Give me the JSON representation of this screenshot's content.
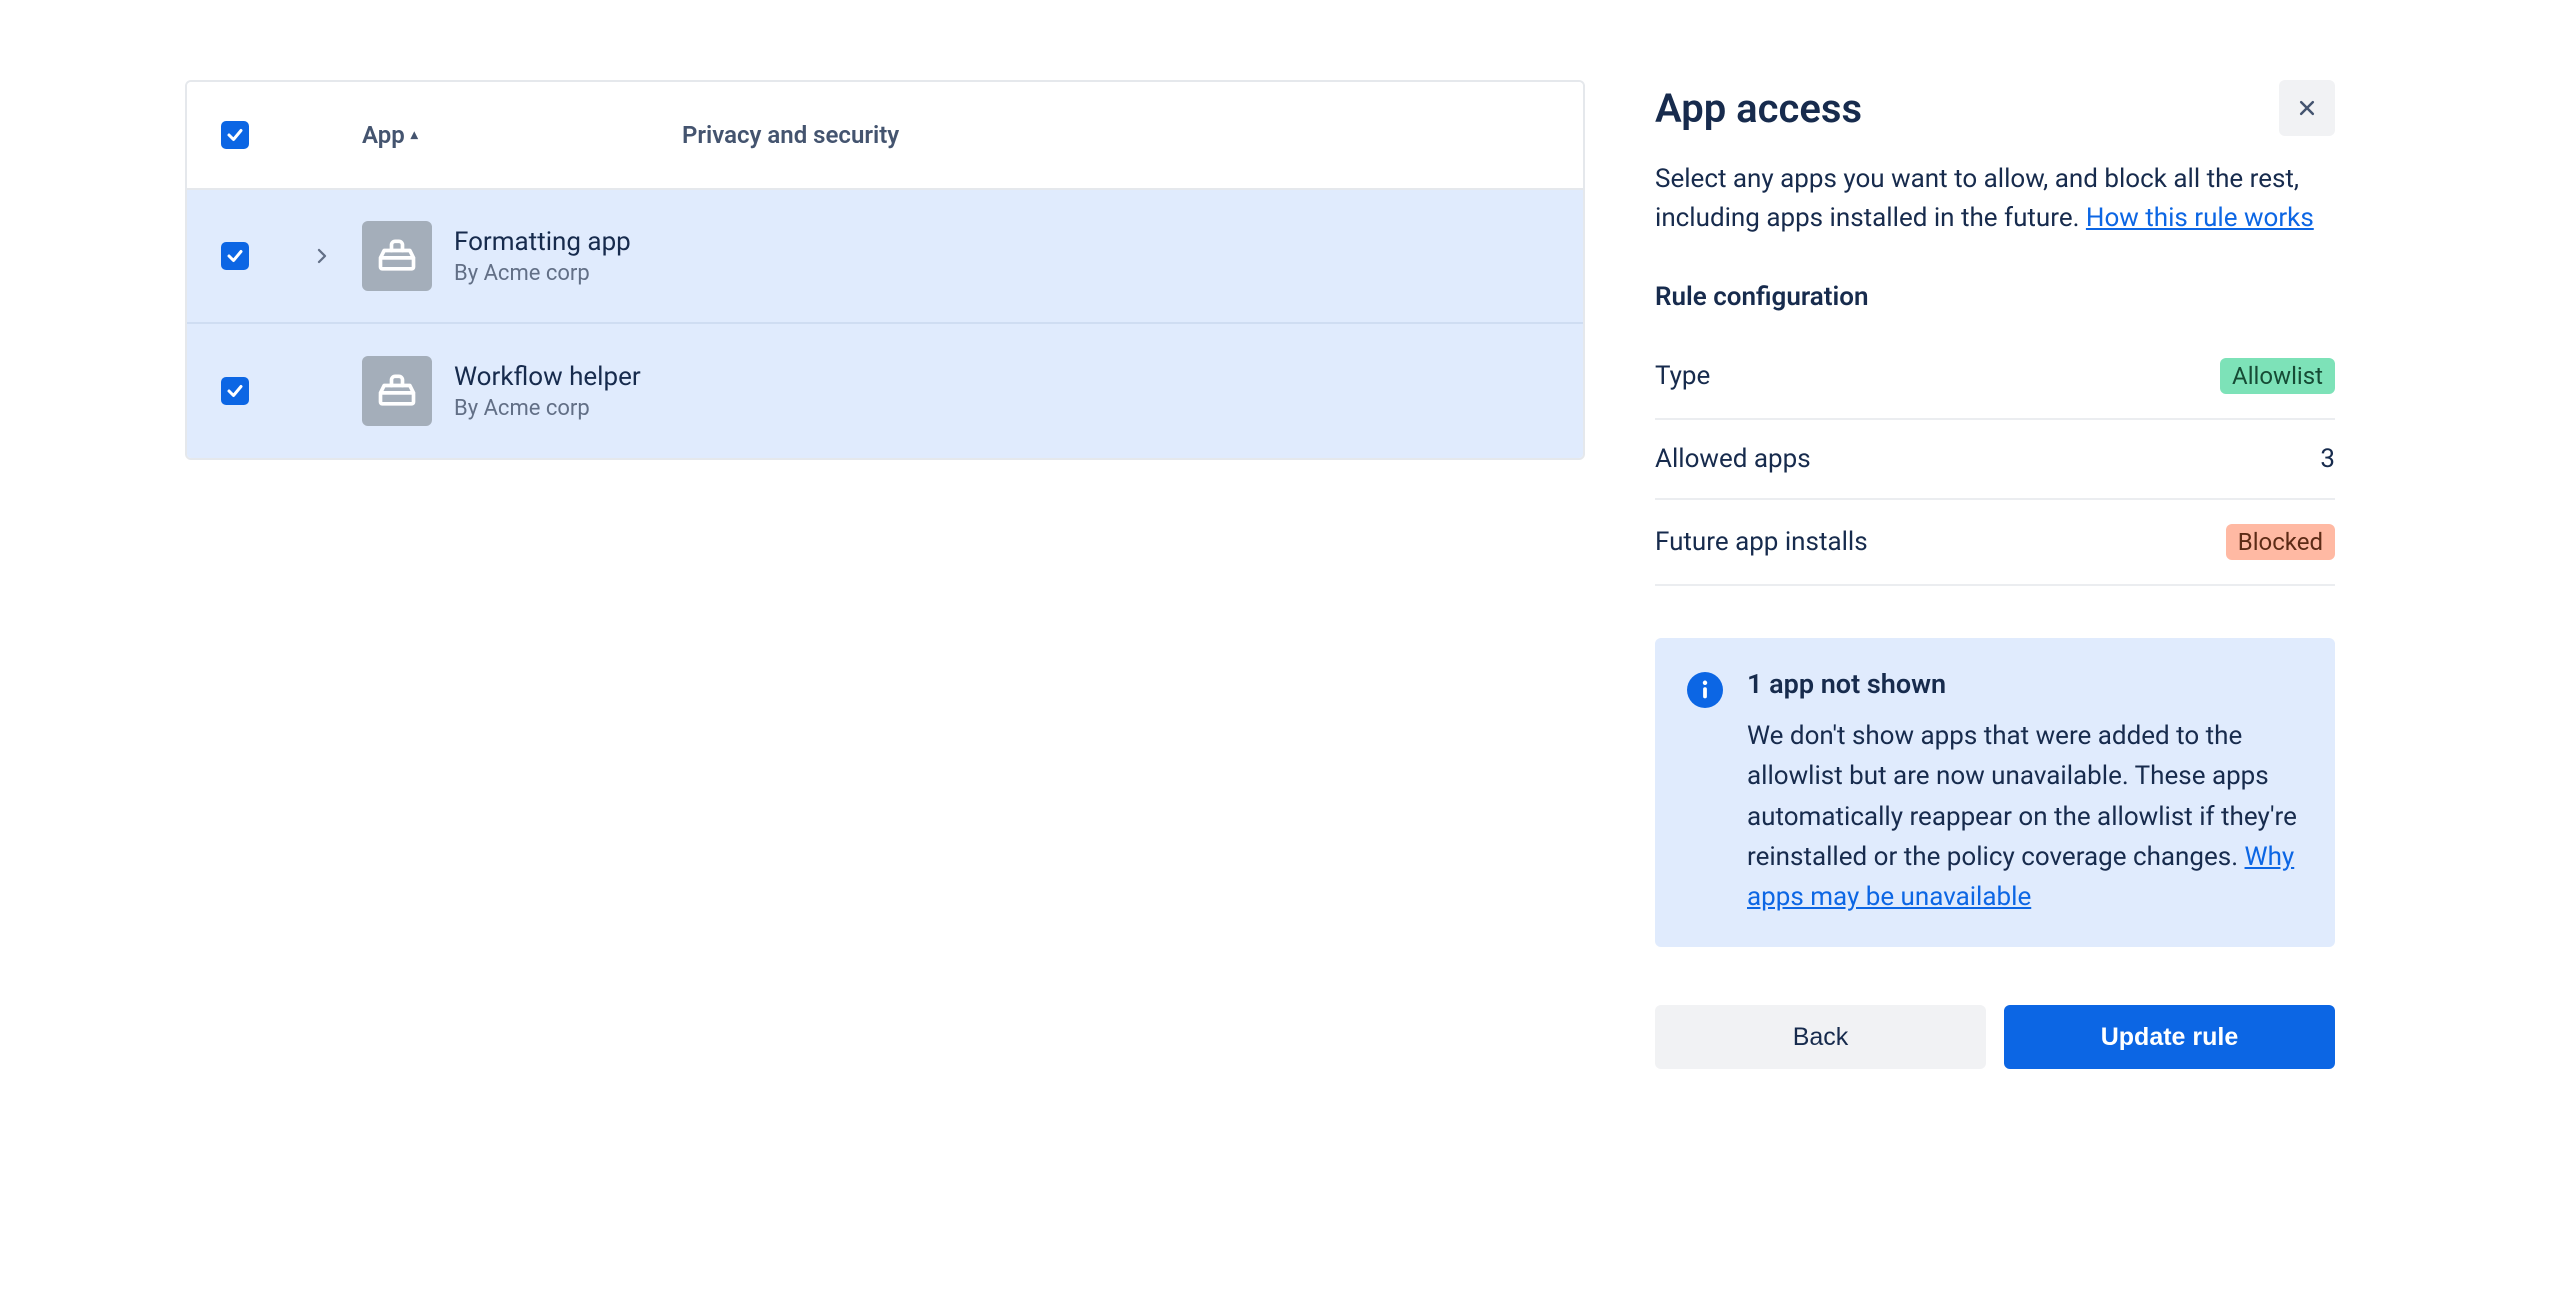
{
  "table": {
    "columns": {
      "app": "App",
      "privacy": "Privacy and security"
    },
    "rows": [
      {
        "name": "Formatting app",
        "vendor": "By Acme corp",
        "expandable": true
      },
      {
        "name": "Workflow helper",
        "vendor": "By Acme corp",
        "expandable": false
      }
    ]
  },
  "panel": {
    "title": "App access",
    "description_pre": "Select any apps you want to allow, and block all the rest, including apps installed in the future. ",
    "description_link": "How this rule works",
    "rule_config_label": "Rule configuration",
    "config": {
      "type_label": "Type",
      "type_value": "Allowlist",
      "allowed_label": "Allowed apps",
      "allowed_value": "3",
      "future_label": "Future app installs",
      "future_value": "Blocked"
    },
    "info": {
      "title": "1 app not shown",
      "body_pre": "We don't show apps that were added to the allowlist but are now unavailable. These apps automatically reappear on the allowlist if they're reinstalled or the policy coverage changes. ",
      "body_link": "Why apps may be unavailable"
    },
    "buttons": {
      "back": "Back",
      "update": "Update rule"
    }
  }
}
